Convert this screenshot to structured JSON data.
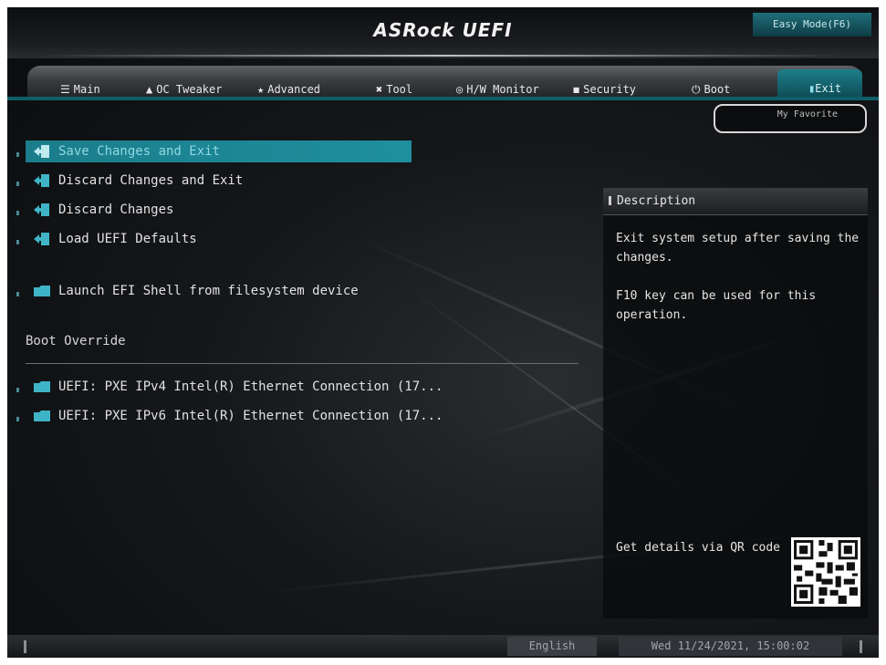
{
  "header": {
    "logo": "ASRock UEFI",
    "easy_mode_label": "Easy Mode(F6)"
  },
  "tabs": [
    {
      "label": "Main",
      "icon": "list-icon"
    },
    {
      "label": "OC Tweaker",
      "icon": "rocket-icon"
    },
    {
      "label": "Advanced",
      "icon": "star-icon"
    },
    {
      "label": "Tool",
      "icon": "tools-icon"
    },
    {
      "label": "H/W Monitor",
      "icon": "monitor-icon"
    },
    {
      "label": "Security",
      "icon": "shield-icon"
    },
    {
      "label": "Boot",
      "icon": "power-icon"
    },
    {
      "label": "Exit",
      "icon": "exit-icon",
      "active": true
    }
  ],
  "favorite_label": "My Favorite",
  "menu": {
    "items": [
      {
        "label": "Save Changes and Exit",
        "icon": "exit-icon",
        "selected": true
      },
      {
        "label": "Discard Changes and Exit",
        "icon": "exit-icon"
      },
      {
        "label": "Discard Changes",
        "icon": "exit-icon"
      },
      {
        "label": "Load UEFI Defaults",
        "icon": "exit-icon"
      },
      {
        "label": "Launch EFI Shell from filesystem device",
        "icon": "folder-icon"
      }
    ],
    "boot_override_label": "Boot Override",
    "boot_items": [
      {
        "label": "UEFI: PXE IPv4 Intel(R) Ethernet Connection (17...",
        "icon": "folder-icon"
      },
      {
        "label": "UEFI: PXE IPv6 Intel(R) Ethernet Connection (17...",
        "icon": "folder-icon"
      }
    ]
  },
  "description": {
    "title": "Description",
    "line1": "Exit system setup after saving the changes.",
    "line2": "F10 key can be used for this operation.",
    "qr_label": "Get details via QR code"
  },
  "status": {
    "language": "English",
    "datetime": "Wed 11/24/2021, 15:00:02"
  },
  "colors": {
    "accent": "#1b7d8b",
    "background": "#111315"
  }
}
